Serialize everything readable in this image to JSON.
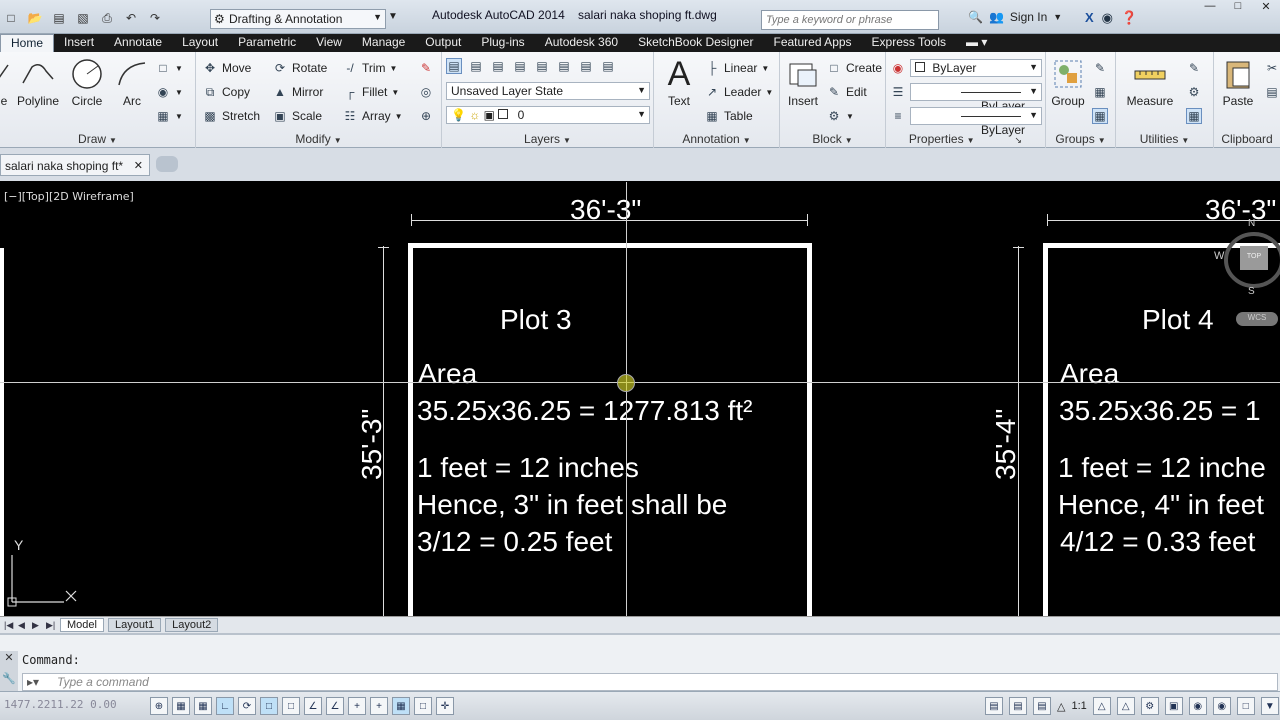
{
  "titlebar": {
    "workspace": "Drafting & Annotation",
    "app_title": "Autodesk AutoCAD 2014",
    "file_title": "salari naka shoping ft.dwg",
    "search_placeholder": "Type a keyword or phrase",
    "sign_in": "Sign In"
  },
  "ribbon_tabs": [
    "Home",
    "Insert",
    "Annotate",
    "Layout",
    "Parametric",
    "View",
    "Manage",
    "Output",
    "Plug-ins",
    "Autodesk 360",
    "SketchBook Designer",
    "Featured Apps",
    "Express Tools"
  ],
  "draw_panel": {
    "label": "Draw",
    "line_label": "e",
    "polyline": "Polyline",
    "circle": "Circle",
    "arc": "Arc"
  },
  "modify_panel": {
    "label": "Modify",
    "move": "Move",
    "rotate": "Rotate",
    "trim": "Trim",
    "copy": "Copy",
    "mirror": "Mirror",
    "fillet": "Fillet",
    "stretch": "Stretch",
    "scale": "Scale",
    "array": "Array"
  },
  "layers_panel": {
    "label": "Layers",
    "layer_state": "Unsaved Layer State",
    "current_layer": "0"
  },
  "annotation_panel": {
    "label": "Annotation",
    "text": "Text",
    "linear": "Linear",
    "leader": "Leader",
    "table": "Table"
  },
  "block_panel": {
    "label": "Block",
    "insert": "Insert",
    "create": "Create",
    "edit": "Edit"
  },
  "properties_panel": {
    "label": "Properties",
    "color": "ByLayer",
    "linetype": "ByLayer",
    "lineweight": "ByLayer"
  },
  "groups_panel": {
    "label": "Groups",
    "group": "Group"
  },
  "utilities_panel": {
    "label": "Utilities",
    "measure": "Measure"
  },
  "clipboard_panel": {
    "label": "Clipboard",
    "paste": "Paste"
  },
  "doc_tab": {
    "name": "salari naka shoping ft*"
  },
  "viewport": {
    "label": "[−][Top][2D Wireframe]"
  },
  "drawing": {
    "plot3": {
      "width_dim": "36'-3\"",
      "height_dim": "35'-3\"",
      "title": "Plot 3",
      "area_label": "Area",
      "area_calc": "35.25x36.25 =  1277.813 ft²",
      "note1": "1 feet = 12 inches",
      "note2": "Hence, 3\" in feet shall be",
      "note3": "3/12 = 0.25 feet"
    },
    "plot4": {
      "width_dim": "36'-3\"",
      "height_dim": "35'-4\"",
      "title": "Plot 4",
      "area_label": "Area",
      "area_calc": "35.25x36.25 =  1",
      "note1": "1 feet = 12 inche",
      "note2": "Hence, 4\" in feet",
      "note3": "4/12 = 0.33 feet"
    }
  },
  "viewcube": {
    "n": "N",
    "w": "W",
    "s": "S",
    "top": "TOP",
    "wcs": "WCS"
  },
  "ucs": {
    "y": "Y"
  },
  "layout_tabs": [
    "Model",
    "Layout1",
    "Layout2"
  ],
  "command": {
    "history": "Command:",
    "placeholder": "Type a command"
  },
  "status": {
    "coords": "1477.2211.22  0.00",
    "annotation_scale": "1:1"
  }
}
